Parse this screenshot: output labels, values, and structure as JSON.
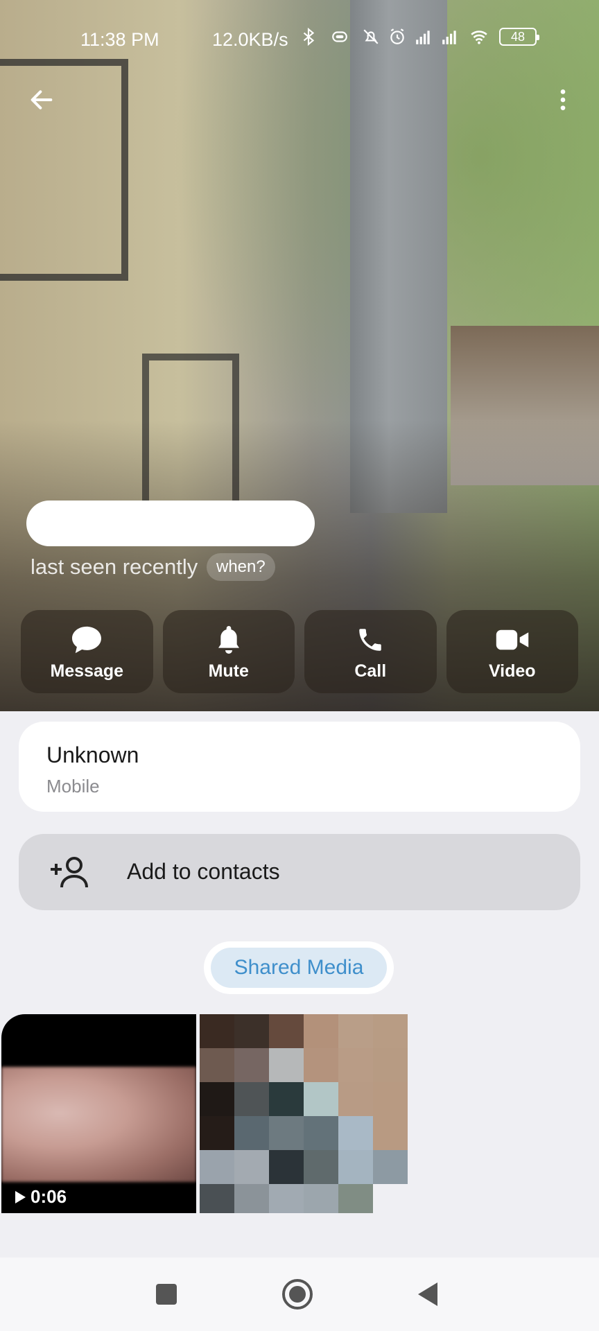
{
  "status_bar": {
    "time": "11:38 PM",
    "net_speed": "12.0KB/s",
    "battery": "48",
    "icons": [
      "bluetooth-icon",
      "vibrate-icon",
      "bell-muted-icon",
      "alarm-icon",
      "signal-icon",
      "signal-icon",
      "wifi-icon",
      "battery-icon"
    ]
  },
  "profile": {
    "last_seen": "last seen recently",
    "when_label": "when?"
  },
  "actions": [
    {
      "label": "Message",
      "icon": "message-bubble-icon"
    },
    {
      "label": "Mute",
      "icon": "bell-icon"
    },
    {
      "label": "Call",
      "icon": "phone-icon"
    },
    {
      "label": "Video",
      "icon": "video-camera-icon"
    }
  ],
  "info": {
    "phone": "Unknown",
    "phone_type": "Mobile"
  },
  "add_contact": {
    "label": "Add to contacts",
    "icon": "add-person-icon"
  },
  "tabs": {
    "shared_media": "Shared Media"
  },
  "media": [
    {
      "duration": "0:06",
      "kind": "video"
    },
    {
      "kind": "photo"
    }
  ],
  "colors": {
    "accent": "#3f8fcb",
    "background": "#efeff3"
  }
}
